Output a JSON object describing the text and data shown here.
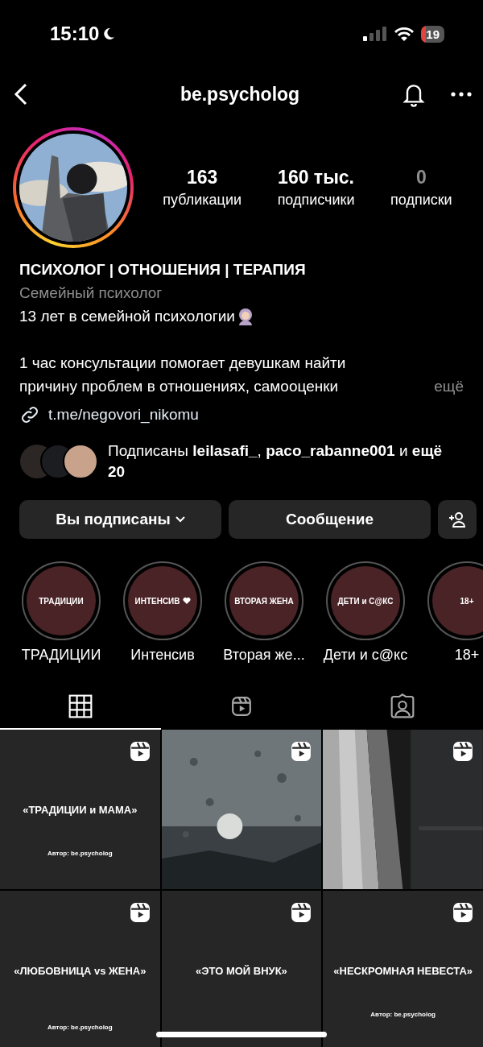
{
  "status_bar": {
    "time": "15:10",
    "battery": "19"
  },
  "header": {
    "title": "be.psycholog"
  },
  "stats": [
    {
      "value": "163",
      "label": "публикации",
      "dimmed": false
    },
    {
      "value": "160 тыс.",
      "label": "подписчики",
      "dimmed": false
    },
    {
      "value": "0",
      "label": "подписки",
      "dimmed": true
    }
  ],
  "profile": {
    "name": "ПСИХОЛОГ | ОТНОШЕНИЯ | ТЕРАПИЯ",
    "category": "Семейный психолог",
    "bio_first": "13 лет в семейной психологии",
    "bio": [
      "1 час консультации помогает девушкам найти",
      "причину проблем в отношениях, самооценки"
    ],
    "more": "ещё",
    "link": "t.me/negovori_nikomu"
  },
  "followed_by": "Подписаны **leilasafi_**, **paco_rabanne001** и **ещё 20**",
  "buttons": [
    {
      "label": "Вы подписаны",
      "kind": "dropdown"
    },
    {
      "label": "Сообщение",
      "kind": "plain"
    }
  ],
  "highlights": [
    {
      "cover": "ТРАДИЦИИ",
      "heart": false,
      "label": "ТРАДИЦИИ"
    },
    {
      "cover": "ИНТЕНСИВ",
      "heart": true,
      "label": "Интенсив"
    },
    {
      "cover": "ВТОРАЯ ЖЕНА",
      "heart": false,
      "label": "Вторая же..."
    },
    {
      "cover": "ДЕТИ и С@КС",
      "heart": false,
      "label": "Дети и с@кс"
    },
    {
      "cover": "18+",
      "heart": false,
      "label": "18+"
    }
  ],
  "tabs": [
    {
      "kind": "grid",
      "selected": true
    },
    {
      "kind": "reels",
      "selected": false
    },
    {
      "kind": "tagged",
      "selected": false
    }
  ],
  "posts": [
    {
      "kind": "text",
      "title": "«ТРАДИЦИИ и МАМА»",
      "author": "Автор: be.psycholog"
    },
    {
      "kind": "picture"
    },
    {
      "kind": "picture"
    },
    {
      "kind": "text",
      "title": "«ЛЮБОВНИЦА vs ЖЕНА»",
      "author": "Автор: be.psycholog"
    },
    {
      "kind": "text",
      "title": "«ЭТО МОЙ ВНУК»"
    },
    {
      "kind": "text",
      "title": "«НЕСКРОМНАЯ НЕВЕСТА»",
      "author": "Автор: be.psycholog"
    }
  ]
}
